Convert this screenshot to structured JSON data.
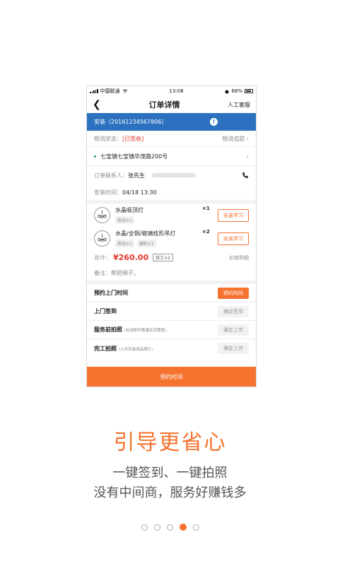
{
  "status_bar": {
    "carrier": "中国联通",
    "time": "13:08",
    "battery": "68%"
  },
  "nav": {
    "title": "订单详情",
    "service": "人工客服"
  },
  "banner": {
    "text": "安装（20161234567806）"
  },
  "logistics": {
    "label": "物流状态：",
    "status": "[已签收]",
    "track": "物流追踪"
  },
  "address": "七宝镇七宝镇华茂路200号",
  "contact": {
    "label": "订单联系人：",
    "name": "张先生"
  },
  "install_time": {
    "label": "安装时间：",
    "value": "04/18 13:30"
  },
  "items": [
    {
      "name": "水晶吸顶灯",
      "tags": [
        "拆旧×1"
      ],
      "qty": "×1",
      "button": "安装学习"
    },
    {
      "name": "水晶/全铜/玻璃枝形吊灯",
      "tags": [
        "拆旧×1",
        "辅料×1"
      ],
      "qty": "×2",
      "button": "安装学习"
    }
  ],
  "total": {
    "label": "总计：",
    "price": "¥260.00",
    "badge": "技工×2",
    "detail": "价格明细"
  },
  "remark": "备注：帮把梯子。",
  "tasks": [
    {
      "label": "预约上门时间",
      "hint": "",
      "button": "预约时间"
    },
    {
      "label": "上门签到",
      "hint": "",
      "button": "确定签到"
    },
    {
      "label": "服务前拍照",
      "hint": "(检验配件数量及完整度)",
      "button": "确定上传"
    },
    {
      "label": "完工拍照",
      "hint": "(上传安装成品照片)",
      "button": "确定上传"
    }
  ],
  "bottom_button": "预约时间",
  "headline": "引导更省心",
  "subtitle1": "一键签到、一键拍照",
  "subtitle2": "没有中间商，服务好赚钱多",
  "pagination": {
    "count": 5,
    "active_index": 3
  },
  "colors": {
    "accent": "#f5722f",
    "banner": "#2b71bf",
    "price": "#e2362d"
  }
}
